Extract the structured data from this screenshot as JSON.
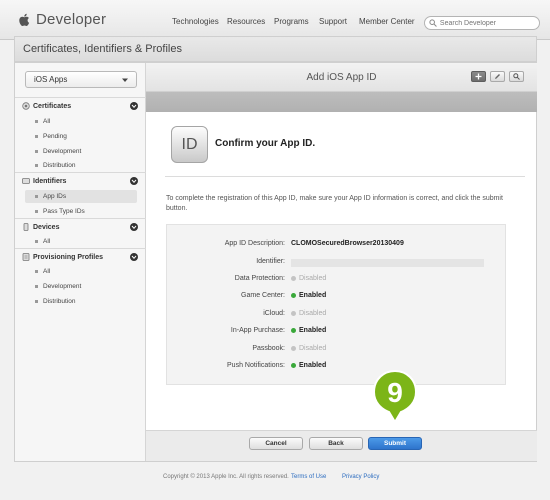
{
  "brand": {
    "name": "Developer"
  },
  "nav": {
    "items": [
      "Technologies",
      "Resources",
      "Programs",
      "Support",
      "Member Center"
    ]
  },
  "search": {
    "placeholder": "Search Developer"
  },
  "section": {
    "title": "Certificates, Identifiers & Profiles"
  },
  "sidebar": {
    "platform": "iOS Apps",
    "groups": [
      {
        "label": "Certificates",
        "items": [
          "All",
          "Pending",
          "Development",
          "Distribution"
        ]
      },
      {
        "label": "Identifiers",
        "items": [
          "App IDs",
          "Pass Type IDs"
        ],
        "active_item": "App IDs"
      },
      {
        "label": "Devices",
        "items": [
          "All"
        ]
      },
      {
        "label": "Provisioning Profiles",
        "items": [
          "All",
          "Development",
          "Distribution"
        ]
      }
    ]
  },
  "content": {
    "title": "Add iOS App ID",
    "badge": "ID",
    "heading": "Confirm your App ID.",
    "intro": "To complete the registration of this App ID, make sure your App ID information is correct, and click the submit button.",
    "details": [
      {
        "label": "App ID Description:",
        "value": "CLOMOSecuredBrowser20130409",
        "status": "text"
      },
      {
        "label": "Identifier:",
        "value": "",
        "status": "hidden"
      },
      {
        "label": "Data Protection:",
        "value": "Disabled",
        "status": "disabled"
      },
      {
        "label": "Game Center:",
        "value": "Enabled",
        "status": "enabled"
      },
      {
        "label": "iCloud:",
        "value": "Disabled",
        "status": "disabled"
      },
      {
        "label": "In-App Purchase:",
        "value": "Enabled",
        "status": "enabled"
      },
      {
        "label": "Passbook:",
        "value": "Disabled",
        "status": "disabled"
      },
      {
        "label": "Push Notifications:",
        "value": "Enabled",
        "status": "enabled"
      }
    ]
  },
  "buttons": {
    "cancel": "Cancel",
    "back": "Back",
    "submit": "Submit"
  },
  "step_marker": "9",
  "footer": {
    "copyright": "Copyright © 2013 Apple Inc. All rights reserved.",
    "terms": "Terms of Use",
    "privacy": "Privacy Policy"
  },
  "colors": {
    "accent": "#2e74cc",
    "enabled": "#3aa83a",
    "disabled": "#c4c4c4",
    "marker": "#7cb518"
  }
}
